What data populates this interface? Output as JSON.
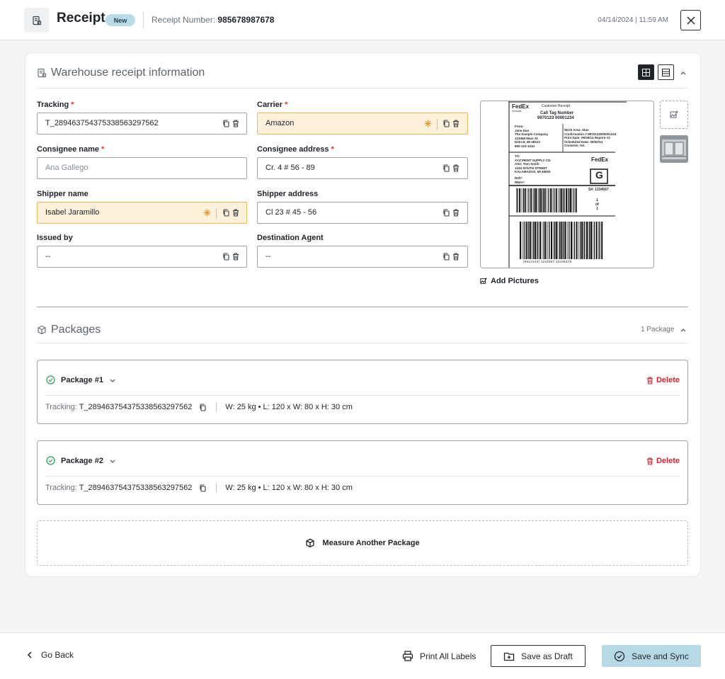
{
  "header": {
    "title": "Receipt",
    "badge": "New",
    "receipt_number_label": "Receipt Number:",
    "receipt_number": "985678987678",
    "datetime": "04/14/2024 | 11:59 AM"
  },
  "warehouse": {
    "title": "Warehouse receipt information",
    "fields": {
      "tracking": {
        "label": "Tracking",
        "required": "*",
        "value": "T_289463754375338563297562"
      },
      "carrier": {
        "label": "Carrier",
        "required": "*",
        "value": "Amazon"
      },
      "consignee_name": {
        "label": "Consignee name",
        "required": "*",
        "placeholder": "Ana Gallego"
      },
      "consignee_address": {
        "label": "Consignee address",
        "required": "*",
        "value": "Cr. 4 # 56 - 89"
      },
      "shipper_name": {
        "label": "Shipper name",
        "value": "Isabel Jaramillo"
      },
      "shipper_address": {
        "label": "Shipper address",
        "value": "Cl 23 # 45 - 56"
      },
      "issued_by": {
        "label": "Issued by",
        "value": "--"
      },
      "destination_agent": {
        "label": "Destination Agent",
        "value": "--"
      }
    },
    "add_pictures": "Add Pictures",
    "shipping_label": {
      "brand": "FedEx",
      "brand_sub": "Ground",
      "customer_receipt": "Customer Receipt",
      "call_tag_title": "Call Tag Number",
      "call_tag_number": "9970123  00001234",
      "from_lines": [
        "From:",
        "Jane Doe",
        "The Sample Company",
        "123456 Main St.",
        "Detroit, MI 48223",
        "800-123-1234"
      ],
      "work_lines": [
        "Work Area:  Stan",
        "Confirmation #:9970123000001234",
        "Print Date: 09/26/14   Reprint #2",
        "Scheduled Date:   09/30/14",
        "Contents:   NA"
      ],
      "to_lines": [
        "TO:",
        "XYZ PRINT SUPPLY CO.",
        "Attn: Tom Smith",
        "1234 SOUTH STREET",
        "KALAMAZOO, MI 49002"
      ],
      "refs": [
        "Ref#:",
        "RMA#:"
      ],
      "g_mark": "G",
      "s_number": "S#: 1234567",
      "piece": [
        "1",
        "of",
        "1"
      ],
      "barcode_text": "(9612143)  1234567    12345678"
    }
  },
  "packages": {
    "title": "Packages",
    "count": "1 Package",
    "items": [
      {
        "name": "Package #1",
        "delete": "Delete",
        "tracking_label": "Tracking:",
        "tracking": "T_289463754375338563297562",
        "dims": "W: 25 kg • L: 120 x W: 80 x H: 30 cm"
      },
      {
        "name": "Package #2",
        "delete": "Delete",
        "tracking_label": "Tracking:",
        "tracking": "T_289463754375338563297562",
        "dims": "W: 25 kg • L: 120 x W: 80 x H: 30 cm"
      }
    ],
    "measure_another": "Measure Another Package"
  },
  "footer": {
    "go_back": "Go Back",
    "print_all": "Print All Labels",
    "save_draft": "Save as Draft",
    "save_sync": "Save and Sync"
  },
  "colors": {
    "accent_sync": "#b6d9e6",
    "badge": "#b9dbe8",
    "highlight_field": "#fdf1dc",
    "danger": "#d3232f",
    "success": "#2e9e5a"
  }
}
